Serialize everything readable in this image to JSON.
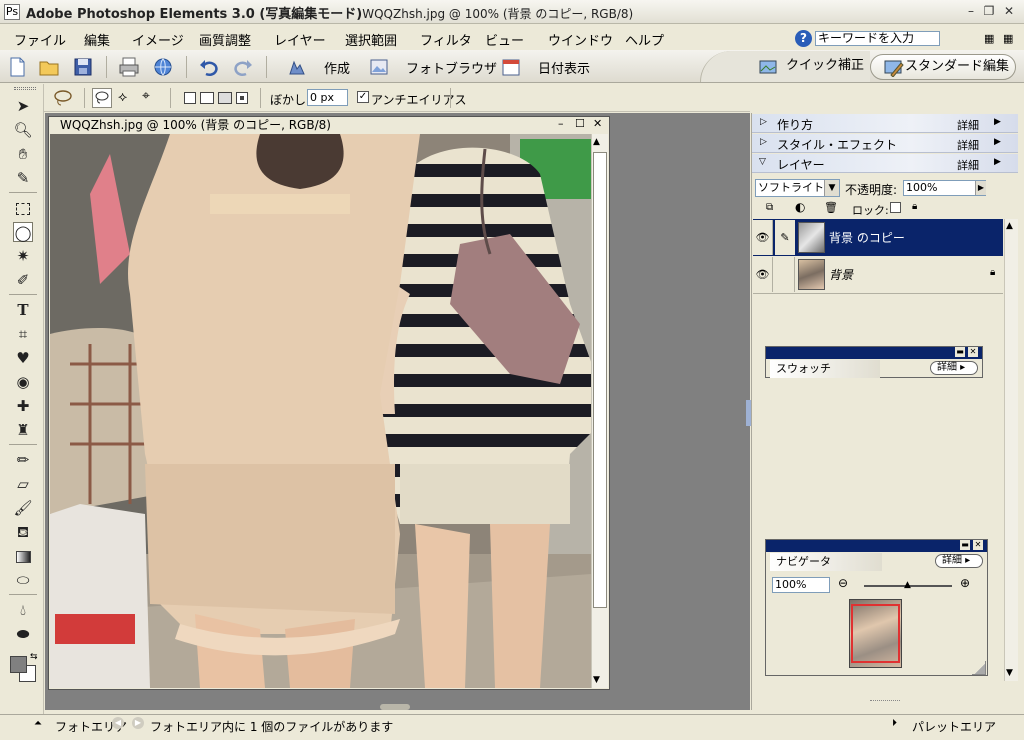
{
  "window": {
    "app_title": "Adobe Photoshop Elements 3.0 (写真編集モード)",
    "file_title": "WQQZhsh.jpg @ 100% (背景 のコピー, RGB/8)",
    "min_glyph": "–",
    "restore_glyph": "❐",
    "close_glyph": "✕"
  },
  "menu": {
    "items": [
      "ファイル",
      "編集",
      "イメージ",
      "画質調整",
      "レイヤー",
      "選択範囲",
      "フィルタ",
      "ビュー",
      "ウインドウ",
      "ヘルプ"
    ],
    "help_icon": "?",
    "keyword_placeholder": "キーワードを入力"
  },
  "toolbar": {
    "create_label": "作成",
    "browser_label": "フォトブラウザ",
    "date_view_label": "日付表示",
    "quick_fix_label": "クイック補正",
    "standard_edit_label": "スタンダード編集"
  },
  "options": {
    "blur_label": "ぼかし:",
    "blur_value": "0 px",
    "antialias_label": "アンチエイリアス",
    "antialias_checked": true
  },
  "document": {
    "title": "WQQZhsh.jpg @ 100% (背景 のコピー, RGB/8)",
    "zoom": "100%"
  },
  "panels": {
    "more_label": "詳細",
    "how_to": {
      "title": "作り方"
    },
    "styles": {
      "title": "スタイル・エフェクト"
    },
    "layers": {
      "title": "レイヤー",
      "blend_mode": "ソフトライト",
      "opacity_label": "不透明度:",
      "opacity_value": "100%",
      "lock_label": "ロック:",
      "items": [
        {
          "name": "背景 のコピー",
          "selected": true,
          "visible": true
        },
        {
          "name": "背景",
          "selected": false,
          "visible": true,
          "locked": true
        }
      ]
    },
    "swatches": {
      "title": "スウォッチ"
    },
    "navigator": {
      "title": "ナビゲータ",
      "zoom_value": "100%"
    }
  },
  "status": {
    "photo_bin_label": "フォトエリア",
    "photo_bin_info": "フォトエリア内に 1 個のファイルがあります",
    "palette_bin_label": "パレットエリア"
  },
  "colors": {
    "selection": "#0a246a",
    "foreground": "#808080",
    "background": "#ffffff"
  }
}
